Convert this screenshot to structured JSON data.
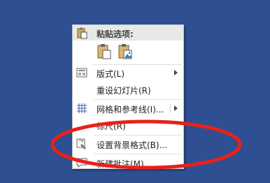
{
  "menu": {
    "paste_header": "粘贴选项:",
    "items": [
      {
        "label": "版式(L)",
        "has_submenu": true,
        "icon": "layout-icon"
      },
      {
        "label": "重设幻灯片(R)",
        "has_submenu": false,
        "icon": ""
      },
      {
        "label": "网格和参考线(I)...",
        "has_submenu": true,
        "icon": "grid-icon"
      },
      {
        "label": "标尺(R)",
        "has_submenu": false,
        "icon": ""
      },
      {
        "label": "设置背景格式(B)...",
        "has_submenu": false,
        "icon": "format-background-icon"
      },
      {
        "label": "新建批注(M)",
        "has_submenu": false,
        "icon": "new-comment-icon"
      }
    ]
  },
  "annotation": {
    "color": "#e8211a"
  }
}
